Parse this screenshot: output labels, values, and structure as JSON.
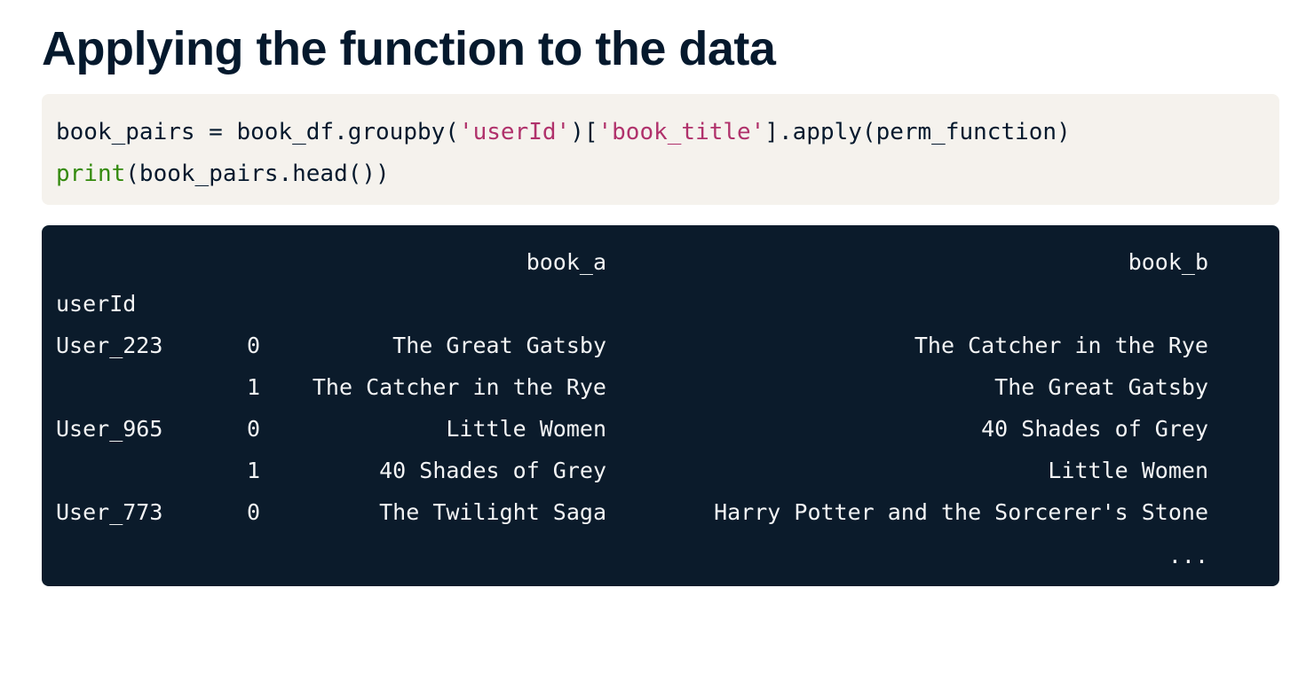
{
  "page_title": "Applying the function to the data",
  "code": {
    "line1": {
      "p1": "book_pairs = book_df.groupby(",
      "s1": "'userId'",
      "p2": ")[",
      "s2": "'book_title'",
      "p3": "].apply(perm_function)"
    },
    "line2": {
      "builtin": "print",
      "rest": "(book_pairs.head())"
    }
  },
  "output": {
    "header": {
      "user": "",
      "idx": "",
      "book_a": "book_a",
      "book_b": "book_b"
    },
    "index_name": "userId",
    "rows": [
      {
        "user": "User_223",
        "idx": "0",
        "book_a": "The Great Gatsby",
        "book_b": "The Catcher in the Rye"
      },
      {
        "user": "",
        "idx": "1",
        "book_a": "The Catcher in the Rye",
        "book_b": "The Great Gatsby"
      },
      {
        "user": "User_965",
        "idx": "0",
        "book_a": "Little Women",
        "book_b": "40 Shades of Grey"
      },
      {
        "user": "",
        "idx": "1",
        "book_a": "40 Shades of Grey",
        "book_b": "Little Women"
      },
      {
        "user": "User_773",
        "idx": "0",
        "book_a": "The Twilight Saga",
        "book_b": "Harry Potter and the Sorcerer's Stone"
      }
    ],
    "ellipsis": "..."
  }
}
